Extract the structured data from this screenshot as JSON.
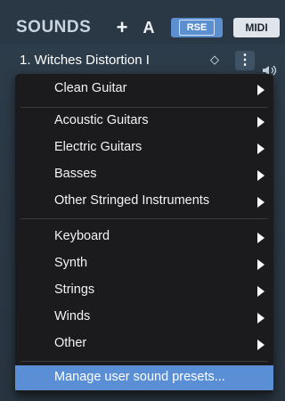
{
  "header": {
    "title": "SOUNDS",
    "add_label": "+",
    "a_label": "A",
    "rse_label": "RSE",
    "midi_label": "MIDI"
  },
  "preset": {
    "name": "1. Witches Distortion I",
    "stepper_symbol": "◇",
    "more_symbol": "⋮"
  },
  "menu": {
    "items": [
      {
        "label": "Clean Guitar",
        "submenu": true
      },
      {
        "label": "Acoustic Guitars",
        "submenu": true
      },
      {
        "label": "Electric Guitars",
        "submenu": true
      },
      {
        "label": "Basses",
        "submenu": true
      },
      {
        "label": "Other Stringed Instruments",
        "submenu": true
      },
      {
        "label": "Keyboard",
        "submenu": true
      },
      {
        "label": "Synth",
        "submenu": true
      },
      {
        "label": "Strings",
        "submenu": true
      },
      {
        "label": "Winds",
        "submenu": true
      },
      {
        "label": "Other",
        "submenu": true
      },
      {
        "label": "Manage user sound presets...",
        "submenu": false,
        "highlighted": true
      }
    ]
  },
  "colors": {
    "accent": "#5a8fd6",
    "menu_bg": "#1b1b1d",
    "panel_bg": "#2b3946"
  }
}
